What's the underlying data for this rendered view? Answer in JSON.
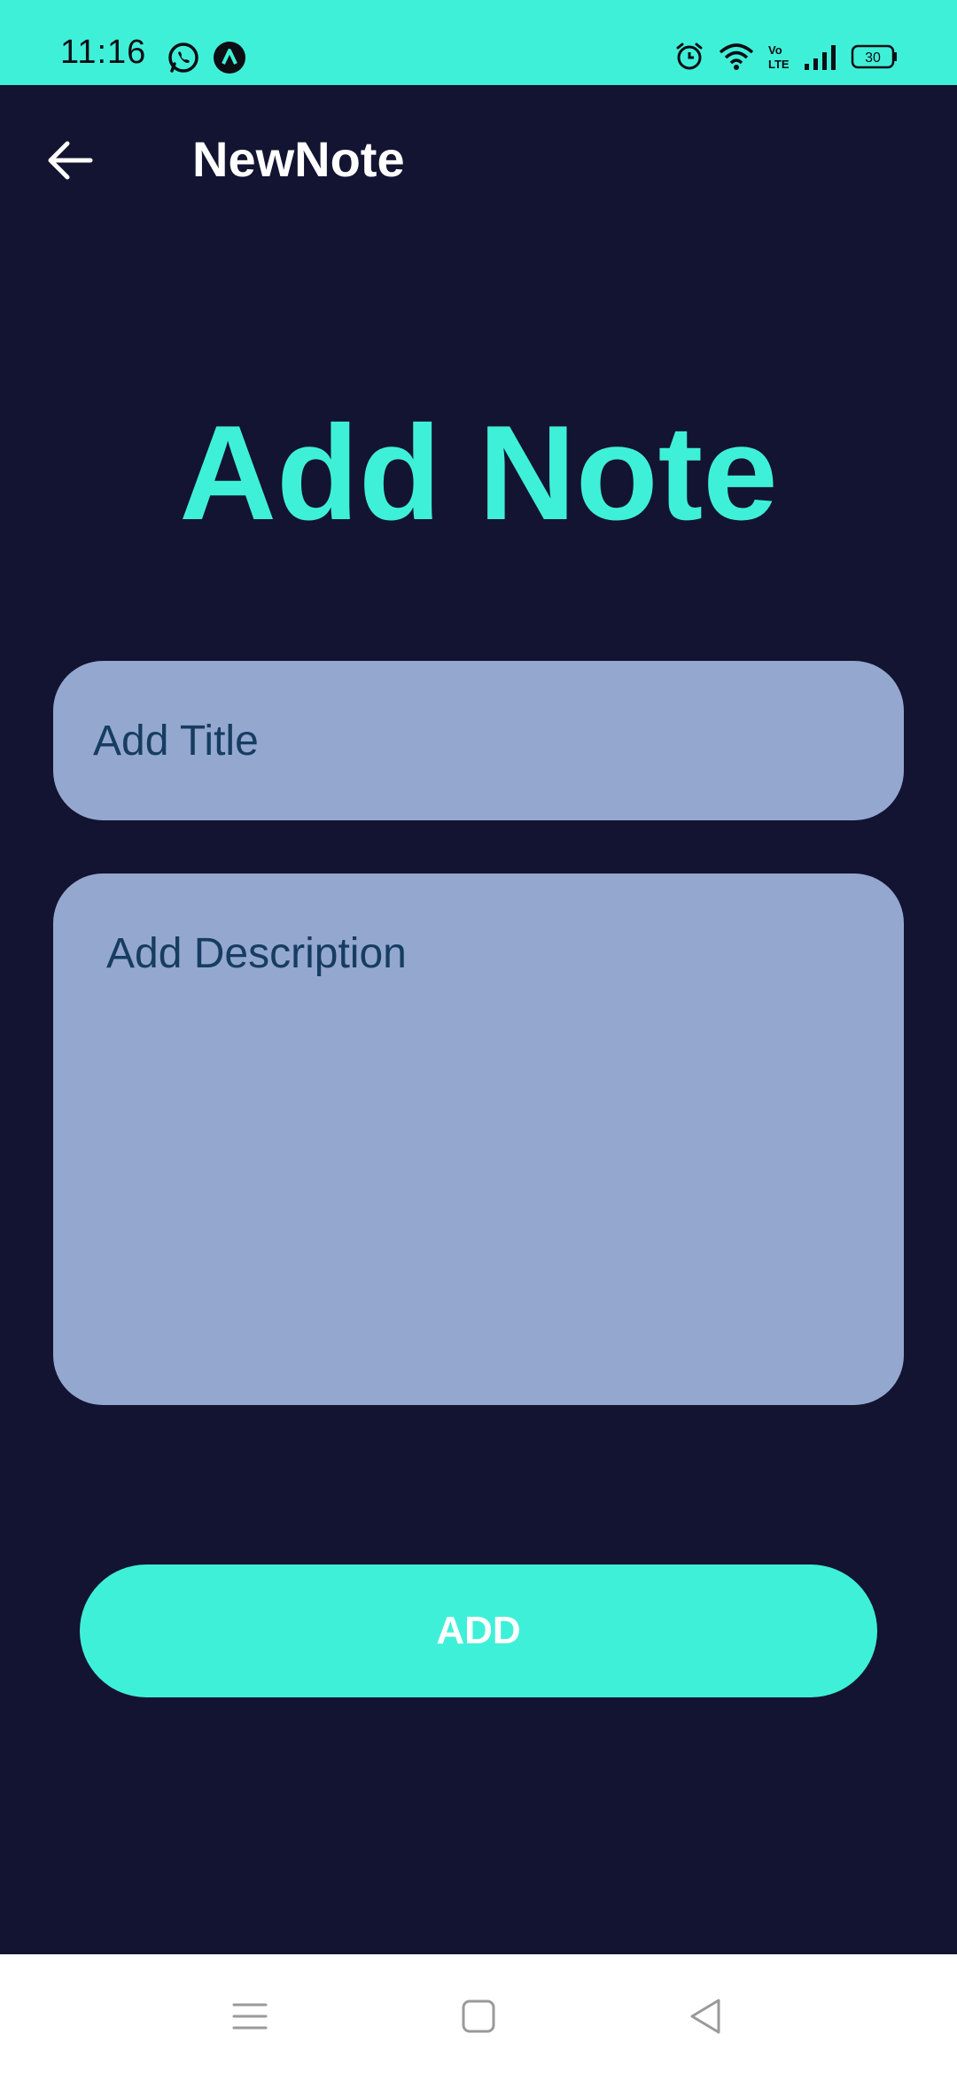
{
  "status_bar": {
    "time": "11:16",
    "battery_level": "30",
    "background_color": "#3ff0d8",
    "left_icons": [
      "whatsapp-icon",
      "app-notification-icon"
    ],
    "right_icons": [
      "alarm-icon",
      "wifi-icon",
      "volte-icon",
      "signal-icon",
      "battery-icon"
    ]
  },
  "app_bar": {
    "title": "NewNote",
    "back_icon": "arrow-left-icon"
  },
  "main": {
    "heading": "Add Note",
    "title_input": {
      "placeholder": "Add Title",
      "value": ""
    },
    "description_input": {
      "placeholder": "Add Description",
      "value": ""
    },
    "add_button_label": "ADD"
  },
  "nav_bar": {
    "items": [
      "menu-icon",
      "home-icon",
      "back-triangle-icon"
    ]
  },
  "colors": {
    "background": "#131431",
    "accent": "#3ff0d8",
    "field_background": "#94a7cf",
    "field_text": "#163d61",
    "text_primary": "#ffffff"
  }
}
